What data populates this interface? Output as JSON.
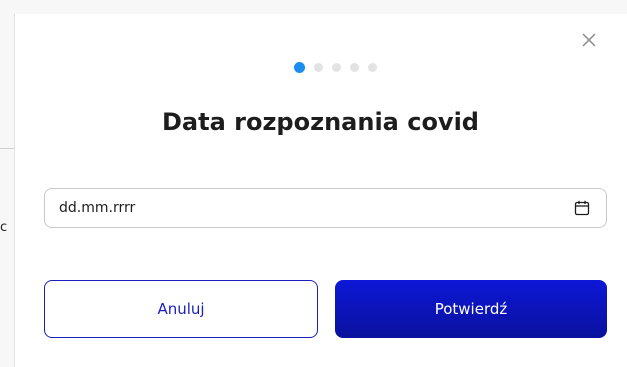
{
  "background": {
    "partial_text": "c"
  },
  "dialog": {
    "close_label": "×",
    "steps": {
      "total": 5,
      "current": 1
    },
    "title": "Data rozpoznania covid",
    "date_input": {
      "placeholder": "dd.mm.rrrr",
      "value": "",
      "icon": "calendar-icon"
    },
    "buttons": {
      "cancel_label": "Anuluj",
      "confirm_label": "Potwierdź"
    }
  },
  "colors": {
    "accent": "#1a8df0",
    "primary": "#0a119e",
    "primary_outline": "#1a1fc0",
    "text": "#1d1d1d"
  }
}
